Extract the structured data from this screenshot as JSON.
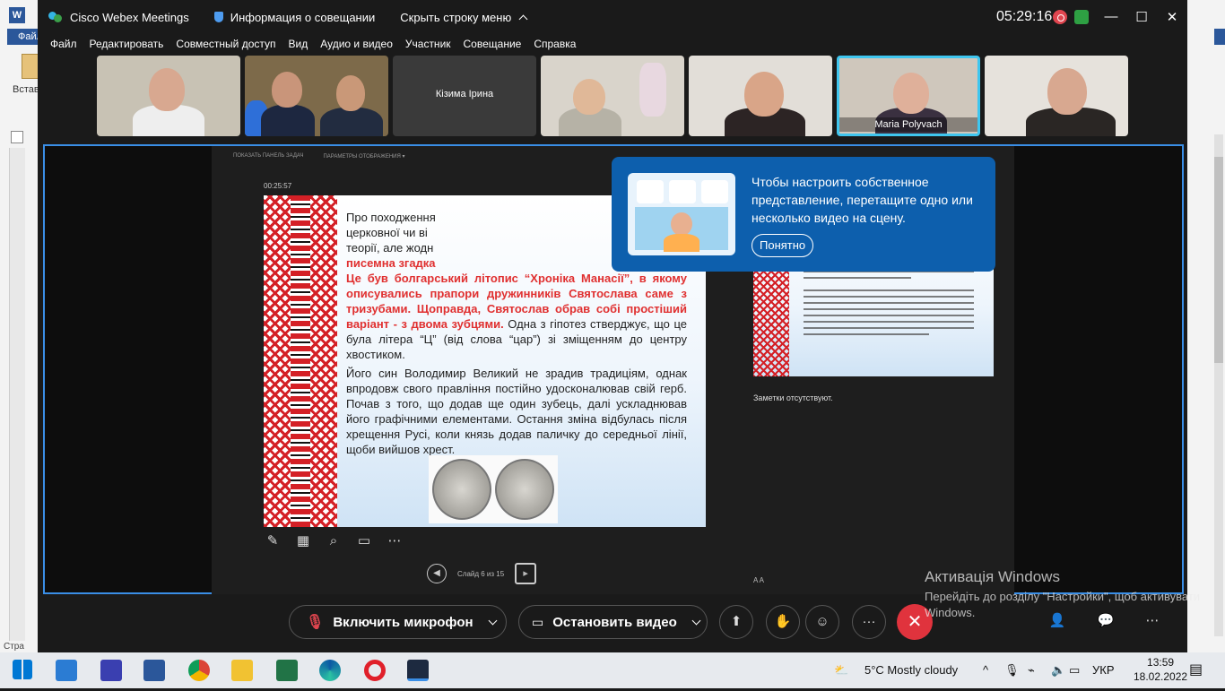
{
  "word": {
    "file_tab": "Файл",
    "paste_label": "Встав",
    "status_page": "Стра"
  },
  "titlebar": {
    "app_name": "Cisco Webex Meetings",
    "meeting_info": "Информация о совещании",
    "hide_menu": "Скрыть строку меню",
    "clock": "05:29:16"
  },
  "menu": [
    "Файл",
    "Редактировать",
    "Совместный доступ",
    "Вид",
    "Аудио и видео",
    "Участник",
    "Совещание",
    "Справка"
  ],
  "participants": [
    {
      "name": ""
    },
    {
      "name": ""
    },
    {
      "name": "Кізима Ірина"
    },
    {
      "name": ""
    },
    {
      "name": ""
    },
    {
      "name": "Maria Polyvach"
    },
    {
      "name": ""
    }
  ],
  "popup": {
    "message": "Чтобы настроить собственное представление, перетащите одно или несколько видео на сцену.",
    "ok_button": "Понятно"
  },
  "presenter": {
    "show_taskbar": "ПОКАЗАТЬ ПАНЕЛЬ ЗАДАЧ",
    "display_settings": "ПАРАМЕТРЫ ОТОБРАЖЕНИЯ ▾",
    "timer": "00:25:57",
    "slide_counter": "Слайд 6 из 15",
    "notes": "Заметки отсутствуют.",
    "font_sizes": "A  A"
  },
  "slide": {
    "p1_start": "Про походження",
    "p1_l2": "церковної чи ві",
    "p1_l3": "теорії, але жодн",
    "p1_red1": "писемна згадка",
    "p1_red2": "Це був болгарський літопис “Хроніка Манасії”, в якому описувались прапори дружинників Святослава саме з тризубами. Щоправда, Святослав обрав собі простіший варіант - з двома зубцями.",
    "p1_end": " Одна з гіпотез стверджує, що це була літера “Ц” (від слова “цар”) зі зміщенням до центру хвостиком.",
    "p2": "Його син Володимир Великий не зрадив традиціям, однак впродовж свого правління постійно удосконалював свій герб. Почав з того, що додав ще один зубець, далі ускладнював його графічними елементами. Остання зміна відбулась після хрещення Русі, коли князь додав паличку до середньої лінії, щоби вийшов хрест."
  },
  "controls": {
    "mic_button": "Включить микрофон",
    "video_button": "Остановить видео",
    "end_icon": "✕",
    "more_icon": "···"
  },
  "activation": {
    "title": "Активація Windows",
    "subtitle": "Перейдіть до розділу \"Настройки\", щоб активувати Windows."
  },
  "taskbar": {
    "weather": "5°C  Mostly cloudy",
    "lang": "УКР",
    "time": "13:59",
    "date": "18.02.2022"
  },
  "colors": {
    "accent": "#0d5fad",
    "end_call": "#e0333d",
    "stage_border": "#3a8ee6"
  }
}
